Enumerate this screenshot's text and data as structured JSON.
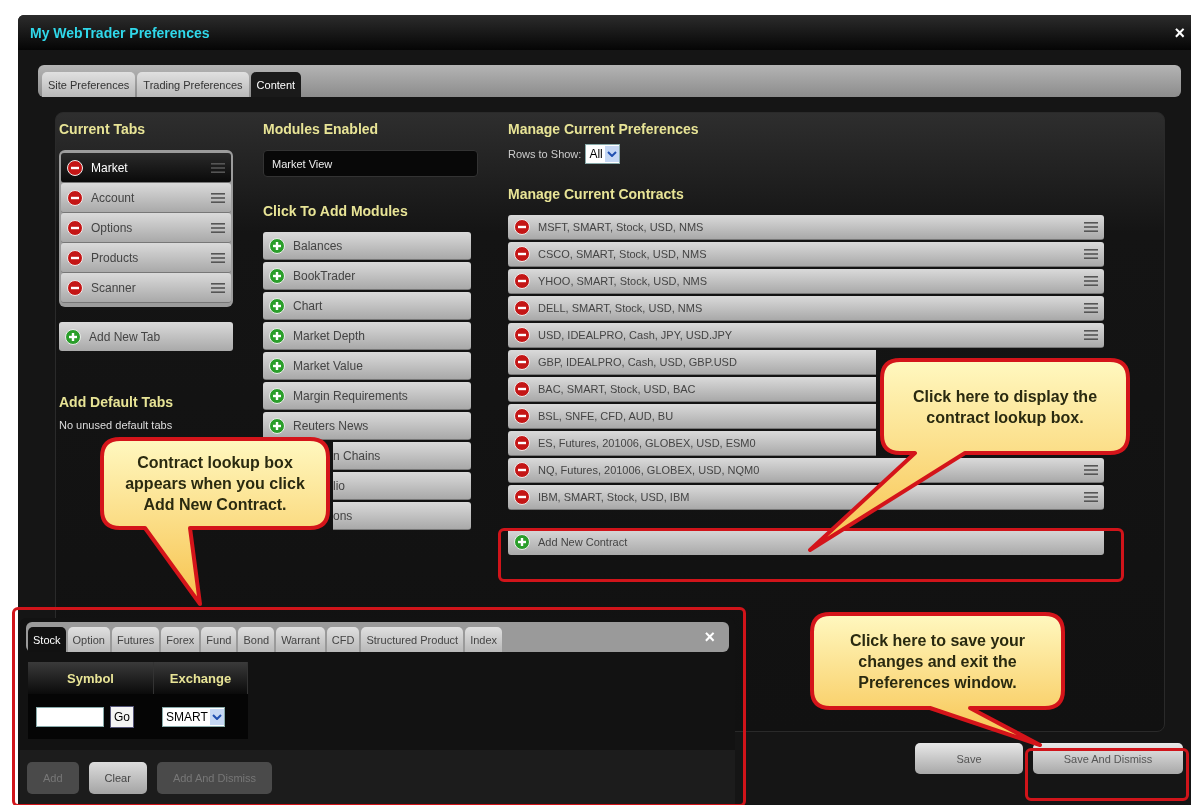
{
  "window": {
    "title": "My WebTrader Preferences",
    "close": "×"
  },
  "tabs": [
    {
      "label": "Site Preferences",
      "selected": false
    },
    {
      "label": "Trading Preferences",
      "selected": false
    },
    {
      "label": "Content",
      "selected": true
    }
  ],
  "current_tabs": {
    "heading": "Current Tabs",
    "items": [
      {
        "label": "Market",
        "selected": true
      },
      {
        "label": "Account",
        "selected": false
      },
      {
        "label": "Options",
        "selected": false
      },
      {
        "label": "Products",
        "selected": false
      },
      {
        "label": "Scanner",
        "selected": false
      }
    ],
    "add_button": "Add New Tab"
  },
  "default_tabs": {
    "heading": "Add Default Tabs",
    "message": "No unused default tabs"
  },
  "modules_enabled": {
    "heading": "Modules Enabled",
    "value": "Market View"
  },
  "add_modules": {
    "heading": "Click To Add Modules",
    "items": [
      {
        "kind": "module",
        "label": "Balances"
      },
      {
        "kind": "module",
        "label": "BookTrader"
      },
      {
        "kind": "module",
        "label": "Chart"
      },
      {
        "kind": "module",
        "label": "Market Depth"
      },
      {
        "kind": "module",
        "label": "Market Value"
      },
      {
        "kind": "module",
        "label": "Margin Requirements"
      },
      {
        "kind": "module",
        "label": "Reuters News"
      },
      {
        "kind": "covered",
        "label": "n Chains"
      },
      {
        "kind": "covered",
        "label": "lio"
      },
      {
        "kind": "covered",
        "label": "ons"
      }
    ]
  },
  "preferences": {
    "heading": "Manage Current Preferences",
    "rows_label": "Rows to Show:",
    "rows_value": "All"
  },
  "contracts": {
    "heading": "Manage Current Contracts",
    "items": [
      {
        "kind": "contract",
        "label": "MSFT, SMART, Stock, USD, NMS"
      },
      {
        "kind": "contract",
        "label": "CSCO, SMART, Stock, USD, NMS"
      },
      {
        "kind": "contract",
        "label": "YHOO, SMART, Stock, USD, NMS"
      },
      {
        "kind": "contract",
        "label": "DELL, SMART, Stock, USD, NMS"
      },
      {
        "kind": "contract",
        "label": "USD, IDEALPRO, Cash, JPY, USD.JPY"
      },
      {
        "kind": "covered",
        "label": "GBP, IDEALPRO, Cash, USD, GBP.USD"
      },
      {
        "kind": "covered",
        "label": "BAC, SMART, Stock, USD, BAC"
      },
      {
        "kind": "covered",
        "label": "BSL, SNFE, CFD, AUD, BU"
      },
      {
        "kind": "covered",
        "label": "ES, Futures, 201006, GLOBEX, USD, ESM0"
      },
      {
        "kind": "contract",
        "label": "NQ, Futures, 201006, GLOBEX, USD, NQM0"
      },
      {
        "kind": "contract",
        "label": "IBM, SMART, Stock, USD, IBM"
      }
    ],
    "add_button": "Add New Contract"
  },
  "lookup": {
    "tabs": [
      {
        "label": "Stock",
        "selected": true
      },
      {
        "label": "Option",
        "selected": false
      },
      {
        "label": "Futures",
        "selected": false
      },
      {
        "label": "Forex",
        "selected": false
      },
      {
        "label": "Fund",
        "selected": false
      },
      {
        "label": "Bond",
        "selected": false
      },
      {
        "label": "Warrant",
        "selected": false
      },
      {
        "label": "CFD",
        "selected": false
      },
      {
        "label": "Structured Product",
        "selected": false
      },
      {
        "label": "Index",
        "selected": false
      }
    ],
    "close": "×",
    "columns": [
      "Symbol",
      "Exchange"
    ],
    "go": "Go",
    "exchange": "SMART",
    "buttons": [
      {
        "label": "Add",
        "disabled": true
      },
      {
        "label": "Clear",
        "disabled": false
      },
      {
        "label": "Add And Dismiss",
        "disabled": true
      }
    ]
  },
  "buttons": [
    {
      "label": "Save"
    },
    {
      "label": "Save And Dismiss"
    }
  ],
  "callouts": [
    {
      "text": "Contract lookup box appears when you click Add New Contract."
    },
    {
      "text": "Click here to display the contract lookup box."
    },
    {
      "text": "Click here to save your changes and exit the Preferences window."
    }
  ]
}
